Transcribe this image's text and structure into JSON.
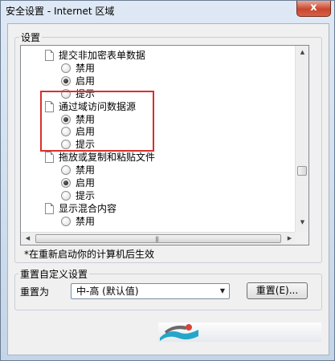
{
  "window": {
    "title": "安全设置 - Internet 区域",
    "close_label": "x"
  },
  "settings": {
    "group_label": "设置",
    "items": [
      {
        "type": "item",
        "label": "提交非加密表单数据"
      },
      {
        "type": "option",
        "label": "禁用",
        "checked": false
      },
      {
        "type": "option",
        "label": "启用",
        "checked": true
      },
      {
        "type": "option",
        "label": "提示",
        "checked": false
      },
      {
        "type": "item",
        "label": "通过域访问数据源"
      },
      {
        "type": "option",
        "label": "禁用",
        "checked": true
      },
      {
        "type": "option",
        "label": "启用",
        "checked": false
      },
      {
        "type": "option",
        "label": "提示",
        "checked": false
      },
      {
        "type": "item",
        "label": "拖放或复制和粘贴文件"
      },
      {
        "type": "option",
        "label": "禁用",
        "checked": false
      },
      {
        "type": "option",
        "label": "启用",
        "checked": true
      },
      {
        "type": "option",
        "label": "提示",
        "checked": false
      },
      {
        "type": "item",
        "label": "显示混合内容"
      },
      {
        "type": "option",
        "label": "禁用",
        "checked": false
      }
    ],
    "restart_note": "*在重新启动你的计算机后生效"
  },
  "reset": {
    "group_label": "重置自定义设置",
    "reset_to_label": "重置为",
    "selected_level": "中-高 (默认值)",
    "reset_button": "重置(E)..."
  },
  "colors": {
    "highlight": "#d9302b",
    "close_button": "#c9462c"
  }
}
